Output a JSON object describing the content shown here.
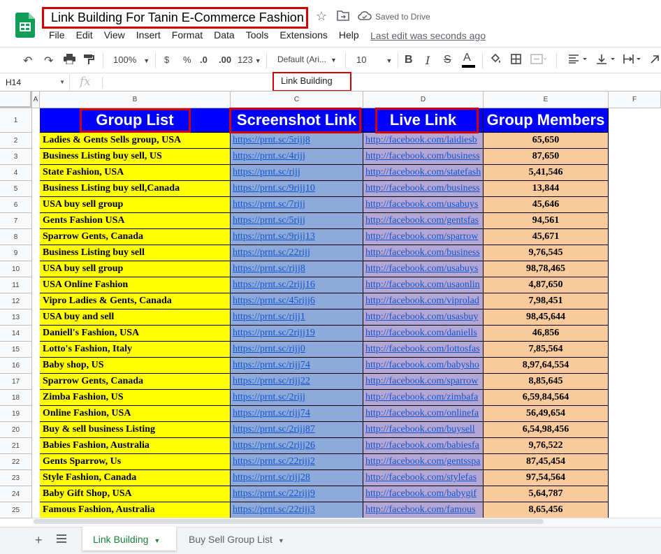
{
  "app": {
    "title": "Link Building For Tanin E-Commerce Fashion",
    "saved_status": "Saved to Drive",
    "last_edit": "Last edit was seconds ago",
    "menu": [
      "File",
      "Edit",
      "View",
      "Insert",
      "Format",
      "Data",
      "Tools",
      "Extensions",
      "Help"
    ]
  },
  "toolbar": {
    "zoom": "100%",
    "currency": "$",
    "percent": "%",
    "dec_decrease": ".0",
    "dec_increase": ".00",
    "more_formats": "123",
    "font": "Default (Ari...",
    "font_size": "10",
    "bold": "B",
    "italic": "I",
    "strike": "S",
    "text_color": "A"
  },
  "formula_bar": {
    "cell_ref": "H14",
    "fx": "fx",
    "value": "Link Building"
  },
  "columns": [
    "A",
    "B",
    "C",
    "D",
    "E",
    "F"
  ],
  "rows": [
    "1",
    "2",
    "3",
    "4",
    "5",
    "6",
    "7",
    "8",
    "9",
    "10",
    "11",
    "12",
    "13",
    "14",
    "15",
    "16",
    "17",
    "18",
    "19",
    "20",
    "21",
    "22",
    "23",
    "24",
    "25"
  ],
  "headers": {
    "group": "Group List",
    "screenshot": "Screenshot Link",
    "live": "Live Link",
    "members": "Group Members"
  },
  "table": [
    {
      "group": "Ladies & Gents Sells group, USA",
      "screenshot": "https://prnt.sc/5rijj8",
      "live": "http://facebook.com/laidiesb",
      "members": "65,650"
    },
    {
      "group": "Business Listing buy sell, US",
      "screenshot": "https://prnt.sc/4rijj",
      "live": "http://facebook.com/business",
      "members": "87,650"
    },
    {
      "group": "State Fashion, USA",
      "screenshot": "https://prnt.sc/rijj",
      "live": "http://facebook.com/statefash",
      "members": "5,41,546"
    },
    {
      "group": "Business Listing buy sell,Canada",
      "screenshot": "https://prnt.sc/9rijj10",
      "live": "http://facebook.com/business",
      "members": "13,844"
    },
    {
      "group": "USA buy sell group",
      "screenshot": "https://prnt.sc/7rijj",
      "live": "http://facebook.com/usabuys",
      "members": "45,646"
    },
    {
      "group": "Gents Fashion USA",
      "screenshot": "https://prnt.sc/5rijj",
      "live": "http://facebook.com/gentsfas",
      "members": "94,561"
    },
    {
      "group": "Sparrow Gents, Canada",
      "screenshot": "https://prnt.sc/9rijj13",
      "live": "http://facebook.com/sparrow",
      "members": "45,671"
    },
    {
      "group": "Business Listing buy sell",
      "screenshot": "https://prnt.sc/22rijj",
      "live": "http://facebook.com/business",
      "members": "9,76,545"
    },
    {
      "group": "USA buy sell group",
      "screenshot": "https://prnt.sc/rijj8",
      "live": "http://facebook.com/usabuys",
      "members": "98,78,465"
    },
    {
      "group": "USA Online Fashion",
      "screenshot": "https://prnt.sc/2rijj16",
      "live": "http://facebook.com/usaonlin",
      "members": "4,87,650"
    },
    {
      "group": "Vipro Ladies & Gents, Canada",
      "screenshot": "https://prnt.sc/45rijj6",
      "live": "http://facebook.com/viprolad",
      "members": "7,98,451"
    },
    {
      "group": "USA buy and sell",
      "screenshot": "https://prnt.sc/rijj1",
      "live": "http://facebook.com/usasbuy",
      "members": "98,45,644"
    },
    {
      "group": "Daniell's Fashion, USA",
      "screenshot": "https://prnt.sc/2rijj19",
      "live": "http://facebook.com/daniells",
      "members": "46,856"
    },
    {
      "group": "Lotto's Fashion, Italy",
      "screenshot": "https://prnt.sc/rijj0",
      "live": "http://facebook.com/lottosfas",
      "members": "7,85,564"
    },
    {
      "group": "Baby shop, US",
      "screenshot": "https://prnt.sc/rijj74",
      "live": "http://facebook.com/babysho",
      "members": "8,97,64,554"
    },
    {
      "group": "Sparrow Gents, Canada",
      "screenshot": "https://prnt.sc/rijj22",
      "live": "http://facebook.com/sparrow",
      "members": "8,85,645"
    },
    {
      "group": "Zimba Fashion, US",
      "screenshot": "https://prnt.sc/2rijj",
      "live": "http://facebook.com/zimbafa",
      "members": "6,59,84,564"
    },
    {
      "group": "Online Fashion, USA",
      "screenshot": "https://prnt.sc/rijj74",
      "live": "http://facebook.com/onlinefa",
      "members": "56,49,654"
    },
    {
      "group": "Buy & sell business Listing",
      "screenshot": "https://prnt.sc/2rijj87",
      "live": "http://facebook.com/buysell",
      "members": "6,54,98,456"
    },
    {
      "group": "Babies Fashion, Australia",
      "screenshot": "https://prnt.sc/2rijj26",
      "live": "http://facebook.com/babiesfa",
      "members": "9,76,522"
    },
    {
      "group": "Gents Sparrow, Us",
      "screenshot": "https://prnt.sc/22rijj2",
      "live": "http://facebook.com/gentsspa",
      "members": "87,45,454"
    },
    {
      "group": "Style Fashion, Canada",
      "screenshot": "https://prnt.sc/rijj28",
      "live": "http://facebook.com/stylefas",
      "members": "97,54,564"
    },
    {
      "group": "Baby Gift Shop, USA",
      "screenshot": "https://prnt.sc/22rijj9",
      "live": "http://facebook.com/babygif",
      "members": "5,64,787"
    },
    {
      "group": "Famous Fashion, Australia",
      "screenshot": "https://prnt.sc/22rijj3",
      "live": "http://facebook.com/famous",
      "members": "8,65,456"
    }
  ],
  "sheets": {
    "tabs": [
      "Link Building",
      "Buy Sell Group List"
    ],
    "active": "Link Building"
  },
  "colors": {
    "header_bg": "#0000ff",
    "group_bg": "#ffff00",
    "screenshot_bg": "#8eaadb",
    "live_bg": "#b4a7d6",
    "members_bg": "#f9cb9c",
    "highlight": "#d40000",
    "sheets_green": "#0f9d58"
  }
}
